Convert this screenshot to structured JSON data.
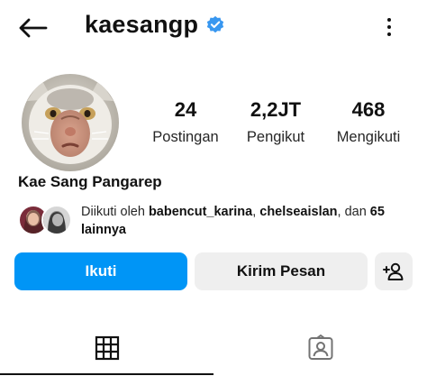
{
  "header": {
    "back_icon": "arrow-left-icon",
    "username": "kaesangp",
    "verified_icon": "verified-badge-icon",
    "verified_color": "#3897f0",
    "more_icon": "more-vertical-icon"
  },
  "profile": {
    "avatar_icon": "profile-photo",
    "full_name": "Kae Sang Pangarep"
  },
  "stats": {
    "posts": {
      "value": "24",
      "label": "Postingan"
    },
    "followers": {
      "value": "2,2JT",
      "label": "Pengikut"
    },
    "following": {
      "value": "468",
      "label": "Mengikuti"
    }
  },
  "followed_by": {
    "prefix": "Diikuti oleh ",
    "user_1": "babencut_karina",
    "separator": ", ",
    "user_2": "chelseaislan",
    "middle": ", dan ",
    "others": "65 lainnya"
  },
  "actions": {
    "follow_label": "Ikuti",
    "message_label": "Kirim Pesan",
    "suggest_icon": "add-person-icon",
    "accent_color": "#0095f6"
  },
  "tabs": [
    {
      "icon": "grid-icon",
      "active": true
    },
    {
      "icon": "tagged-person-icon",
      "active": false
    }
  ]
}
